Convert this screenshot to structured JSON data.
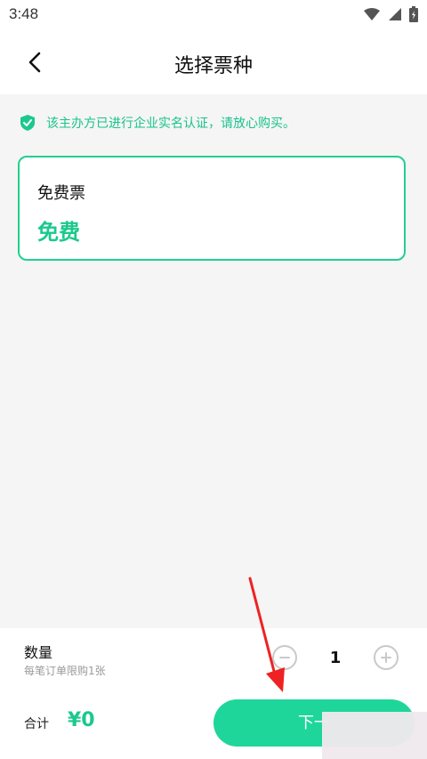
{
  "status_bar": {
    "time": "3:48"
  },
  "header": {
    "title": "选择票种"
  },
  "notice": {
    "text": "该主办方已进行企业实名认证，请放心购买。"
  },
  "ticket": {
    "name": "免费票",
    "price": "免费"
  },
  "quantity": {
    "label": "数量",
    "limit": "每笔订单限购1张",
    "value": "1"
  },
  "total": {
    "label": "合计",
    "amount": "¥0"
  },
  "next_button": {
    "label": "下一"
  },
  "colors": {
    "accent": "#1bc98d",
    "card_border": "#1fd18f",
    "button": "#1fd69a",
    "arrow": "#ee2222"
  },
  "icons": [
    "back-arrow",
    "shield-check",
    "minus-circle",
    "plus-circle",
    "wifi",
    "signal",
    "battery"
  ]
}
